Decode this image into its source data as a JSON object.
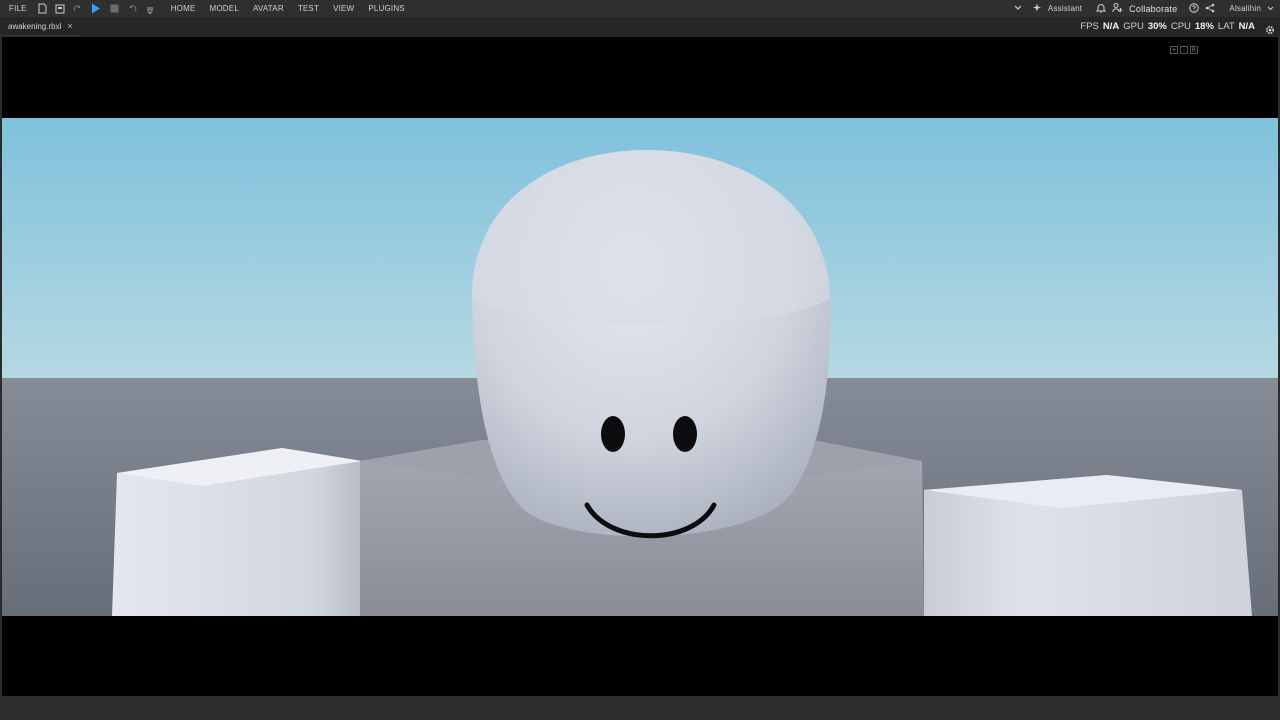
{
  "menu": {
    "file": "FILE",
    "items": [
      "HOME",
      "MODEL",
      "AVATAR",
      "TEST",
      "VIEW",
      "PLUGINS"
    ]
  },
  "toolbar_icons": [
    "new-file-icon",
    "save-icon",
    "redo-icon",
    "play-icon",
    "stop-icon",
    "undo-icon",
    "more-icon"
  ],
  "right_bar": {
    "assistant": "Assistant",
    "collaborate": "Collaborate",
    "user": "Alsalihin"
  },
  "tab": {
    "filename": "awakening.rbxl",
    "close": "×"
  },
  "stats": {
    "fps_label": "FPS",
    "fps_value": "N/A",
    "gpu_label": "GPU",
    "gpu_value": "30%",
    "cpu_label": "CPU",
    "cpu_value": "18%",
    "lat_label": "LAT",
    "lat_value": "N/A"
  },
  "camera_controls": [
    "+",
    "-",
    "R"
  ],
  "colors": {
    "accent_play": "#3b9bff",
    "sky_top": "#7fc1dc",
    "sky_bottom": "#b6d8e2",
    "ground": "#6f7685"
  }
}
